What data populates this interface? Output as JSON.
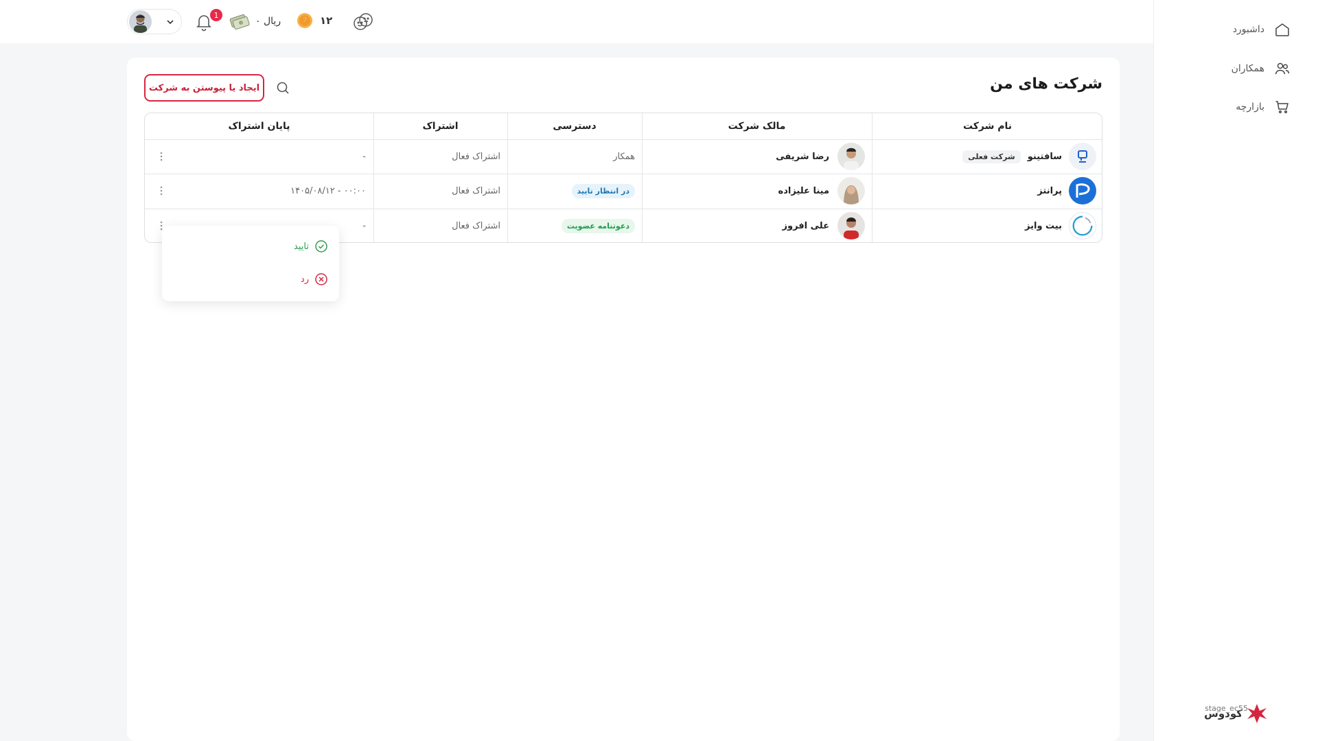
{
  "sidebar": {
    "items": [
      {
        "label": "داشبورد",
        "icon": "home-icon"
      },
      {
        "label": "همکاران",
        "icon": "users-icon"
      },
      {
        "label": "بازارچه",
        "icon": "cart-icon"
      }
    ],
    "brand": {
      "name": "کودوس",
      "stage": "stage_ec55"
    }
  },
  "header": {
    "notification_count": "1",
    "wallet_text": "۰ ریال",
    "coins_count": "۱۲"
  },
  "main": {
    "title": "شرکت های من",
    "create_button": "ایجاد یا پیوستن به شرکت",
    "table": {
      "columns": {
        "company": "نام شرکت",
        "owner": "مالک شرکت",
        "access": "دسترسی",
        "subscription": "اشتراک",
        "end": "پایان اشتراک"
      },
      "rows": [
        {
          "company": "سافتینو",
          "current_badge": "شرکت فعلی",
          "owner": "رضا شریفی",
          "access": "همکار",
          "subscription": "اشتراک فعال",
          "end": "-"
        },
        {
          "company": "پرانتز",
          "owner": "مینا علیزاده",
          "access": "در انتظار تایید",
          "subscription": "اشتراک فعال",
          "end": "۱۴۰۵/۰۸/۱۲ - ۰۰:۰۰"
        },
        {
          "company": "بیت وایز",
          "owner": "علی افروز",
          "access": "دعوتنامه عضویت",
          "subscription": "اشتراک فعال",
          "end": "-"
        }
      ]
    }
  },
  "dropdown": {
    "approve": "تایید",
    "reject": "رد"
  },
  "colors": {
    "accent": "#d6263e",
    "approve": "#2e9e4f",
    "pending": "#1f78b4"
  }
}
